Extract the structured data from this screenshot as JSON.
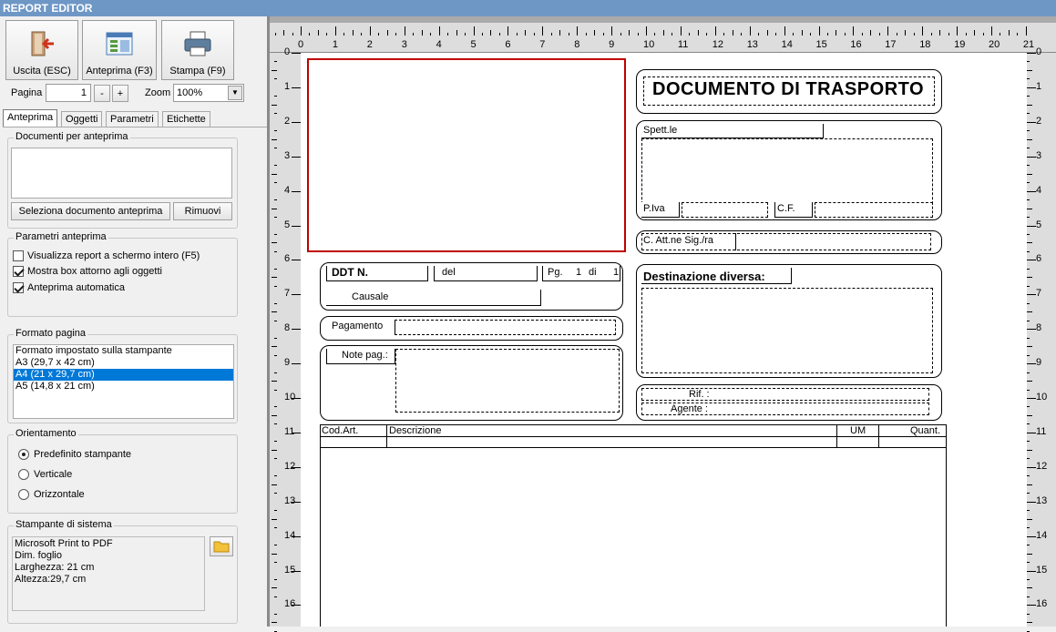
{
  "window": {
    "title": "REPORT EDITOR"
  },
  "toolbar": {
    "exit_label": "Uscita (ESC)",
    "preview_label": "Anteprima (F3)",
    "print_label": "Stampa (F9)",
    "page_label": "Pagina",
    "page_value": "1",
    "minus": "-",
    "plus": "+",
    "zoom_label": "Zoom",
    "zoom_value": "100%"
  },
  "tabs": [
    "Anteprima",
    "Oggetti",
    "Parametri",
    "Etichette"
  ],
  "preview_docs": {
    "title": "Documenti per anteprima",
    "select_btn": "Seleziona documento anteprima",
    "remove_btn": "Rimuovi"
  },
  "preview_params": {
    "title": "Parametri anteprima",
    "options": [
      {
        "label": "Visualizza report a schermo intero (F5)",
        "checked": false
      },
      {
        "label": "Mostra box attorno agli oggetti",
        "checked": true
      },
      {
        "label": "Anteprima automatica",
        "checked": true
      }
    ]
  },
  "page_format": {
    "title": "Formato pagina",
    "items": [
      "Formato impostato sulla stampante",
      "A3 (29,7 x 42 cm)",
      "A4 (21 x 29,7 cm)",
      "A5 (14,8 x 21 cm)"
    ],
    "selected": 2
  },
  "orientation": {
    "title": "Orientamento",
    "options": [
      "Predefinito stampante",
      "Verticale",
      "Orizzontale"
    ],
    "selected": 0
  },
  "printer": {
    "title": "Stampante di sistema",
    "lines": [
      "Microsoft Print to PDF",
      "Dim. foglio",
      "Larghezza: 21 cm",
      "Altezza:29,7 cm"
    ]
  },
  "ruler": {
    "h": [
      "0",
      "1",
      "2",
      "3",
      "4",
      "5",
      "6",
      "7",
      "8",
      "9",
      "10",
      "11",
      "12",
      "13",
      "14",
      "15",
      "16",
      "17",
      "18",
      "19",
      "20",
      "21"
    ],
    "v": [
      "0",
      "1",
      "2",
      "3",
      "4",
      "5",
      "6",
      "7",
      "8",
      "9",
      "10",
      "11",
      "12",
      "13",
      "14",
      "15",
      "16"
    ]
  },
  "report": {
    "title": "DOCUMENTO DI TRASPORTO",
    "spett": "Spett.le",
    "piva": "P.Iva",
    "cf": "C.F.",
    "att": "C. Att.ne Sig./ra",
    "ddt": "DDT N.",
    "del": "del",
    "pg": "Pg.",
    "pg1": "1",
    "di": "di",
    "pg2": "1",
    "causale": "Causale",
    "pagamento": "Pagamento",
    "notepag": "Note pag.:",
    "dest": "Destinazione diversa:",
    "rif": "Rif. :",
    "agente": "Agente :",
    "cols": [
      "Cod.Art.",
      "Descrizione",
      "UM",
      "Quant."
    ]
  },
  "colors": {
    "titlebar": "#6e97c6",
    "selection": "#0078d7",
    "logo_border": "#c00000"
  }
}
